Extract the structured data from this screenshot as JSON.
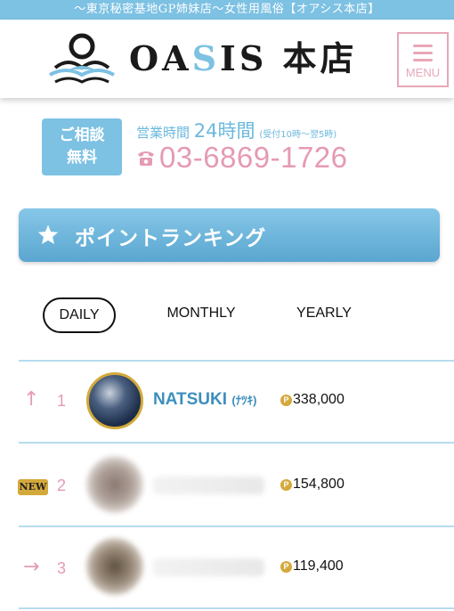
{
  "top_banner": "～東京秘密基地GP姉妹店～女性用風俗【オアシス本店】",
  "logo": {
    "prefix": "OA",
    "accent": "S",
    "suffix": "IS 本店"
  },
  "menu_label": "MENU",
  "consult": {
    "line1": "ご相談",
    "line2": "無料"
  },
  "hours": {
    "label": "営業時間",
    "value": "24時間",
    "note": "(受付10時～翌5時)"
  },
  "phone": "03-6869-1726",
  "ranking_title": "ポイントランキング",
  "tabs": [
    {
      "label": "DAILY",
      "active": true
    },
    {
      "label": "MONTHLY",
      "active": false
    },
    {
      "label": "YEARLY",
      "active": false
    }
  ],
  "rankings": [
    {
      "trend_icon": "arrow-up-icon",
      "trend": "↑",
      "rank": "1",
      "name": "NATSUKI",
      "kana": "(ﾅﾂｷ)",
      "points": "338,000"
    },
    {
      "trend_icon": "new-badge",
      "trend": "NEW",
      "rank": "2",
      "name": "",
      "kana": "",
      "points": "154,800"
    },
    {
      "trend_icon": "arrow-right-icon",
      "trend": "→",
      "rank": "3",
      "name": "",
      "kana": "",
      "points": "119,400"
    }
  ],
  "points_icon": "P",
  "colors": {
    "accent_blue": "#7dc1e3",
    "pink": "#e59ab5",
    "gold": "#d4a93b",
    "name_blue": "#3d8fbd"
  }
}
